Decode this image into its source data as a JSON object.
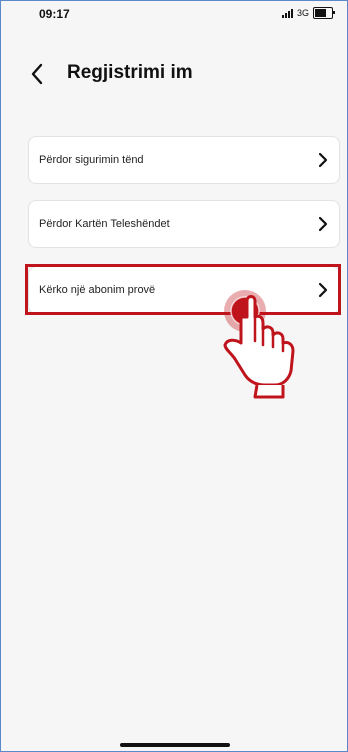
{
  "status_bar": {
    "time": "09:17",
    "network": "3G"
  },
  "header": {
    "title": "Regjistrimi im",
    "back_icon": "chevron-left-icon"
  },
  "options": [
    {
      "label": "Përdor sigurimin tënd",
      "icon": "chevron-right-icon"
    },
    {
      "label": "Përdor Kartën Teleshëndet",
      "icon": "chevron-right-icon"
    },
    {
      "label": "Kërko një abonim provë",
      "icon": "chevron-right-icon",
      "highlighted": true
    }
  ],
  "annotation": {
    "highlight_color": "#c0141c",
    "pointer_icon": "tap-hand-icon"
  }
}
